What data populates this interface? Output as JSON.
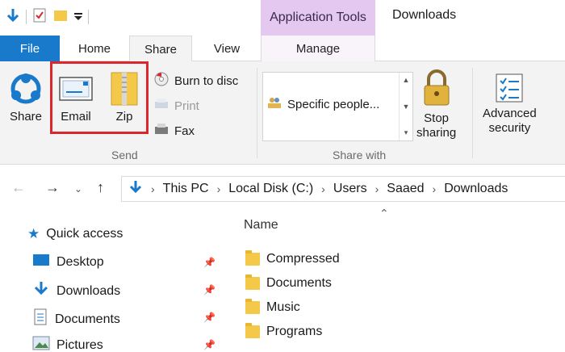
{
  "window": {
    "title": "Downloads",
    "context_tab_header": "Application Tools"
  },
  "tabs": {
    "file": "File",
    "home": "Home",
    "share": "Share",
    "view": "View",
    "manage": "Manage"
  },
  "ribbon": {
    "send_group": {
      "label": "Send",
      "share": "Share",
      "email": "Email",
      "zip": "Zip",
      "burn": "Burn to disc",
      "print": "Print",
      "fax": "Fax"
    },
    "share_with_group": {
      "label": "Share with",
      "specific_people": "Specific people...",
      "stop_sharing_line1": "Stop",
      "stop_sharing_line2": "sharing"
    },
    "advanced_security_line1": "Advanced",
    "advanced_security_line2": "security"
  },
  "address": {
    "crumbs": [
      "This PC",
      "Local Disk (C:)",
      "Users",
      "Saaed",
      "Downloads"
    ]
  },
  "navpane": {
    "quick_access": "Quick access",
    "items": [
      "Desktop",
      "Downloads",
      "Documents",
      "Pictures"
    ]
  },
  "filelist": {
    "column_name": "Name",
    "folders": [
      "Compressed",
      "Documents",
      "Music",
      "Programs"
    ]
  },
  "colors": {
    "accent": "#1979ca",
    "context_tab": "#e4c8f0",
    "highlight": "#d9272e",
    "folder": "#f4c94a"
  }
}
